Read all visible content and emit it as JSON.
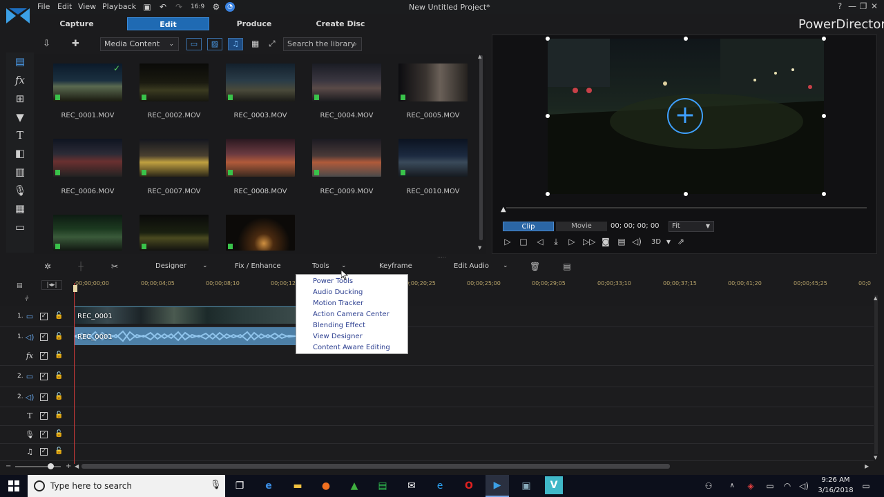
{
  "app": {
    "title": "New Untitled Project*",
    "brand": "PowerDirector",
    "menu": [
      "File",
      "Edit",
      "View",
      "Playback"
    ],
    "modes": [
      "Capture",
      "Edit",
      "Produce",
      "Create Disc"
    ],
    "active_mode": "Edit"
  },
  "library": {
    "filter": "Media Content",
    "search_placeholder": "Search the library",
    "items": [
      "REC_0001.MOV",
      "REC_0002.MOV",
      "REC_0003.MOV",
      "REC_0004.MOV",
      "REC_0005.MOV",
      "REC_0006.MOV",
      "REC_0007.MOV",
      "REC_0008.MOV",
      "REC_0009.MOV",
      "REC_0010.MOV"
    ]
  },
  "preview": {
    "clip_tab": "Clip",
    "movie_tab": "Movie",
    "timecode": "00; 00; 00; 00",
    "zoom": "Fit",
    "mode_3d": "3D"
  },
  "timeline_toolbar": {
    "designer": "Designer",
    "fix_enhance": "Fix / Enhance",
    "tools": "Tools",
    "keyframe": "Keyframe",
    "edit_audio": "Edit Audio"
  },
  "ruler": [
    "00;00;00;00",
    "00;00;04;05",
    "00;00;08;10",
    "00;00;12;",
    "00;00;20;25",
    "00;00;25;00",
    "00;00;29;05",
    "00;00;33;10",
    "00;00;37;15",
    "00;00;41;20",
    "00;00;45;25",
    "00;0"
  ],
  "tracks": {
    "numbers": [
      "1.",
      "1.",
      "",
      "2.",
      "2.",
      "",
      "",
      ""
    ],
    "clips": {
      "video": "REC_0001",
      "audio": "REC_0001"
    }
  },
  "tools_menu": [
    "Power Tools",
    "Audio Ducking",
    "Motion Tracker",
    "Action Camera Center",
    "Blending Effect",
    "View Designer",
    "Content Aware Editing"
  ],
  "taskbar": {
    "search_placeholder": "Type here to search",
    "time": "9:26 AM",
    "date": "3/16/2018"
  },
  "colors": {
    "accent": "#1f6ab3",
    "clip_audio": "#4d7fa6",
    "playhead": "#d13a3a",
    "badge": "#39c24a"
  }
}
